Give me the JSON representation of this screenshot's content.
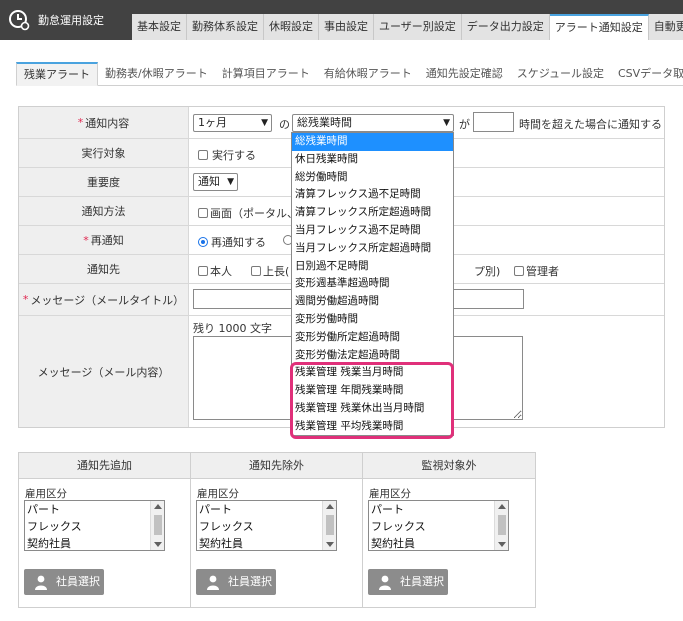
{
  "header": {
    "title": "勤怠運用設定",
    "tabs": [
      "基本設定",
      "勤務体系設定",
      "休暇設定",
      "事由設定",
      "ユーザー別設定",
      "データ出力設定",
      "アラート通知設定",
      "自動更"
    ],
    "active_tab": "アラート通知設定"
  },
  "sub_tabs": {
    "items": [
      "残業アラート",
      "勤務表/休暇アラート",
      "計算項目アラート",
      "有給休暇アラート",
      "通知先設定確認",
      "スケジュール設定",
      "CSVデータ取込"
    ],
    "active": "残業アラート"
  },
  "form": {
    "notify_content": {
      "label": "通知内容",
      "period_value": "1ヶ月",
      "connector_no": "の",
      "item_value": "総残業時間",
      "connector_ga": "が",
      "hours_value": "",
      "suffix": "時間を超えた場合に通知する"
    },
    "target": {
      "label": "実行対象",
      "checkbox_label": "実行する"
    },
    "importance": {
      "label": "重要度",
      "value": "通知"
    },
    "notify_method": {
      "label": "通知方法",
      "option_visible": "画面（ポータル、"
    },
    "renotify": {
      "label": "再通知",
      "option_on": "再通知する"
    },
    "notify_to": {
      "label": "通知先",
      "opt_self": "本人",
      "opt_boss_partial": "上長(",
      "opt_group_partial": "プ別)",
      "opt_admin": "管理者"
    },
    "message_title": {
      "label": "メッセージ（メールタイトル）",
      "value": ""
    },
    "message_body": {
      "label": "メッセージ（メール内容）",
      "remaining": "残り 1000 文字",
      "value": ""
    }
  },
  "dropdown": {
    "options": [
      "総残業時間",
      "休日残業時間",
      "総労働時間",
      "清算フレックス過不足時間",
      "清算フレックス所定超過時間",
      "当月フレックス過不足時間",
      "当月フレックス所定超過時間",
      "日別過不足時間",
      "変形週基準超過時間",
      "週間労働超過時間",
      "変形労働時間",
      "変形労働所定超過時間",
      "変形労働法定超過時間",
      "残業管理 残業当月時間",
      "残業管理 年間残業時間",
      "残業管理 残業休出当月時間",
      "残業管理 平均残業時間"
    ],
    "selected": "総残業時間"
  },
  "panels": [
    {
      "title": "通知先追加",
      "field_label": "雇用区分",
      "options": [
        "パート",
        "フレックス",
        "契約社員"
      ],
      "button": "社員選択"
    },
    {
      "title": "通知先除外",
      "field_label": "雇用区分",
      "options": [
        "パート",
        "フレックス",
        "契約社員"
      ],
      "button": "社員選択"
    },
    {
      "title": "監視対象外",
      "field_label": "雇用区分",
      "options": [
        "パート",
        "フレックス",
        "契約社員"
      ],
      "button": "社員選択"
    }
  ],
  "colors": {
    "header_bg": "#424242",
    "tab_accent": "#4aa3df",
    "required_mark": "#e0264f",
    "selected_option": "#1e90ff",
    "highlight": "#e0307a",
    "button_bg": "#8c8c8c"
  },
  "icons": {
    "logo": "clock-gear-icon",
    "dropdown_caret": "chevron-down-icon",
    "employee_button": "person-icon"
  }
}
